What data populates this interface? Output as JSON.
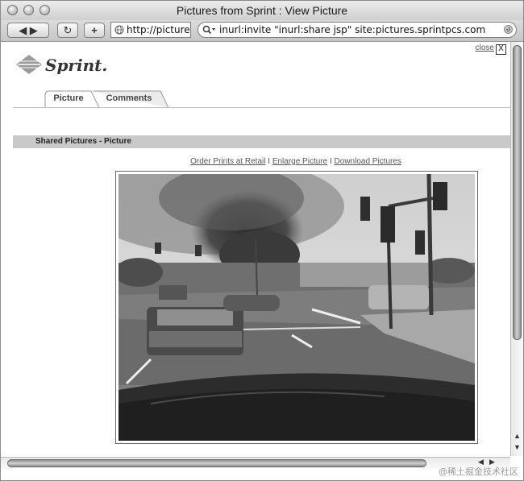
{
  "window": {
    "title": "Pictures from Sprint : View Picture"
  },
  "toolbar": {
    "back_forward": "◀ ▶",
    "reload": "↻",
    "add": "+",
    "url": "http://picture",
    "search_query": "inurl:invite  \"inurl:share jsp\" site:pictures.sprintpcs.com"
  },
  "page": {
    "close_label": "close",
    "close_x": "X",
    "logo_text": "Sprint.",
    "tabs": [
      {
        "label": "Picture",
        "active": true
      },
      {
        "label": "Comments",
        "active": false
      }
    ],
    "section_title": "Shared Pictures - Picture",
    "links": [
      "Order Prints at Retail",
      "Enlarge Picture",
      "Download Pictures"
    ],
    "link_separator": "I"
  },
  "scrollbars": {
    "up": "▲",
    "down": "▼",
    "left": "◀",
    "right": "▶"
  },
  "watermark": "@稀土掘金技术社区"
}
